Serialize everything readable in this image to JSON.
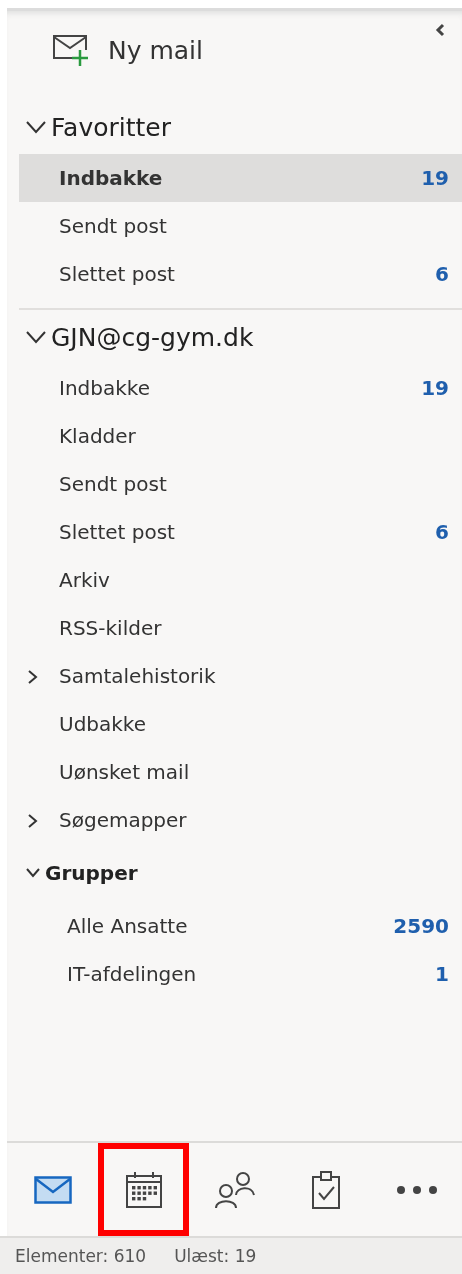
{
  "new_mail_button": {
    "label": "Ny mail"
  },
  "sections": [
    {
      "title": "Favoritter",
      "kind": "favorites",
      "expanded": true,
      "items": [
        {
          "label": "Indbakke",
          "count": "19",
          "selected": true,
          "has_subfolders": false
        },
        {
          "label": "Sendt post",
          "selected": false,
          "has_subfolders": false
        },
        {
          "label": "Slettet post",
          "count": "6",
          "selected": false,
          "has_subfolders": false
        }
      ]
    },
    {
      "title": "GJN@cg-gym.dk",
      "kind": "account",
      "expanded": true,
      "items": [
        {
          "label": "Indbakke",
          "count": "19",
          "selected": false,
          "has_subfolders": false
        },
        {
          "label": "Kladder",
          "selected": false,
          "has_subfolders": false
        },
        {
          "label": "Sendt post",
          "selected": false,
          "has_subfolders": false
        },
        {
          "label": "Slettet post",
          "count": "6",
          "selected": false,
          "has_subfolders": false
        },
        {
          "label": "Arkiv",
          "selected": false,
          "has_subfolders": false
        },
        {
          "label": "RSS-kilder",
          "selected": false,
          "has_subfolders": false
        },
        {
          "label": "Samtalehistorik",
          "selected": false,
          "has_subfolders": true
        },
        {
          "label": "Udbakke",
          "selected": false,
          "has_subfolders": false
        },
        {
          "label": "Uønsket mail",
          "selected": false,
          "has_subfolders": false
        },
        {
          "label": "Søgemapper",
          "selected": false,
          "has_subfolders": true
        }
      ]
    },
    {
      "title": "Grupper",
      "kind": "groups",
      "expanded": true,
      "items": [
        {
          "label": "Alle Ansatte",
          "count": "2590",
          "selected": false,
          "has_subfolders": false
        },
        {
          "label": "IT-afdelingen",
          "count": "1",
          "selected": false,
          "has_subfolders": false
        }
      ]
    }
  ],
  "nav_bar": [
    {
      "kind": "mail",
      "selected": true,
      "highlighted": false
    },
    {
      "kind": "calendar",
      "selected": false,
      "highlighted": true
    },
    {
      "kind": "people",
      "selected": false,
      "highlighted": false
    },
    {
      "kind": "tasks",
      "selected": false,
      "highlighted": false
    },
    {
      "kind": "more",
      "selected": false,
      "highlighted": false
    }
  ],
  "status_bar": [
    "Elementer: 610",
    "Ulæst: 19"
  ]
}
